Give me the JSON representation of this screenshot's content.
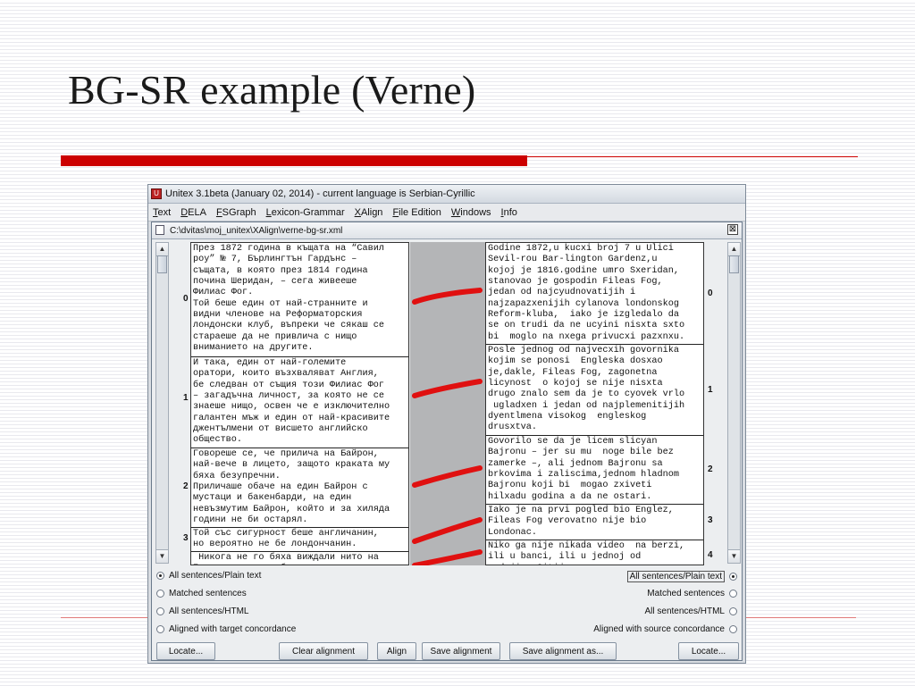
{
  "slide": {
    "title": "BG-SR example (Verne)"
  },
  "app": {
    "title": "Unitex 3.1beta (January 02, 2014) - current language is Serbian-Cyrillic",
    "menu": [
      {
        "mnemonic": "T",
        "rest": "ext"
      },
      {
        "mnemonic": "D",
        "rest": "ELA"
      },
      {
        "mnemonic": "F",
        "rest": "SGraph"
      },
      {
        "mnemonic": "L",
        "rest": "exicon-Grammar"
      },
      {
        "mnemonic": "X",
        "rest": "Align"
      },
      {
        "mnemonic": "F",
        "rest": "ile Edition"
      },
      {
        "mnemonic": "W",
        "rest": "indows"
      },
      {
        "mnemonic": "I",
        "rest": "nfo"
      }
    ]
  },
  "window": {
    "title": "C:\\dvitas\\moj_unitex\\XAlign\\verne-bg-sr.xml",
    "close_label": "⊠"
  },
  "source": {
    "indices": [
      "0",
      "1",
      "2",
      "3"
    ],
    "segments": [
      "През 1872 година в къщата на “Савил\nроу” № 7, Бърлингтън Гардънс –\nсъщата, в която през 1814 година\nпочина Шеридан, – сега живееше\nФилиас Фог.\nТой беше един от най-странните и\nвидни членове на Реформаторския\nлондонски клуб, въпреки че сякаш се\nстараеше да не привлича с нищо\nвниманието на другите.",
      "И така, един от най-големите\nоратори, които възхваляват Англия,\nбе следван от същия този Филиас Фог\n– загадъчна личност, за която не се\nзнаеше нищо, освен че е изключително\nгалантен мъж и един от най-красивите\nджентълмени от висшето английско\nобщество.",
      "Говореше се, че прилича на Байрон,\nнай-вече в лицето, защото краката му\nбяха безупречни.\nПрилича͏ше обаче на един Байрон с\nмустаци и бакенбарди, на един\nневъзмутим Байрон, който и за хиляда\nгодини не би остарял.",
      "Той със сигурност беше англичанин,\nно вероятно не бе лондончанин.",
      " Никога не го бяха виждали нито на\nБорсата, нито в банката, нито"
    ]
  },
  "target": {
    "indices": [
      "0",
      "1",
      "2",
      "3",
      "4"
    ],
    "segments": [
      "Godine 1872,u kucxi broj 7 u Ulici\nSevil-rou Bar-lington Gardenz,u\nkojoj je 1816.godine umro Sxeridan,\nstanovao je gospodin Fileas Fog,\njedan od najcyudnovatijih i\nnajzapazxenijih cylanova londonskog\nReform-kluba,  iako je izgledalo da\nse on trudi da ne ucyini nisxta sxto\nbi  moglo na nxega privucxi pazxnxu.",
      "Posle jednog od najvecxih govornika\nkojim se ponosi  Engleska dosxao\nje,dakle, Fileas Fog, zagonetna\nlicynost  o kojoj se nije nisxta\ndrugo znalo sem da je to cyovek vrlo\n ugladxen i jedan od najplemenitijih\ndyentlmena visokog  engleskog\ndrusxtva.",
      "Govorilo se da je licem slicyan\nBajronu – jer su mu  noge bile bez\nzamerke –, ali jednom Bajronu sa\nbrkovima i zaliscima,jednom hladnom\nBajronu koji bi  mogao zxiveti\nhilxadu godina a da ne ostari.",
      "Iako je na prvi pogled bio Englez,\nFileas Fog verovatno nije bio\nLondonac.",
      "Niko ga nije nikada video  na berzi,\nili u banci, ili u jednoj od\nradnji u Sitiju."
    ]
  },
  "options": {
    "left": [
      "All sentences/Plain text",
      "Matched sentences",
      "All sentences/HTML",
      "Aligned with target concordance"
    ],
    "right": [
      "All sentences/Plain text",
      "Matched sentences",
      "All sentences/HTML",
      "Aligned with source concordance"
    ],
    "selected_index": 0
  },
  "buttons": {
    "locate_left": "Locate...",
    "clear_alignment": "Clear alignment",
    "align": "Align",
    "save_alignment": "Save alignment",
    "save_alignment_as": "Save alignment as...",
    "locate_right": "Locate..."
  },
  "colors": {
    "accent_red": "#cc0000",
    "alignment_link": "#e01010"
  }
}
